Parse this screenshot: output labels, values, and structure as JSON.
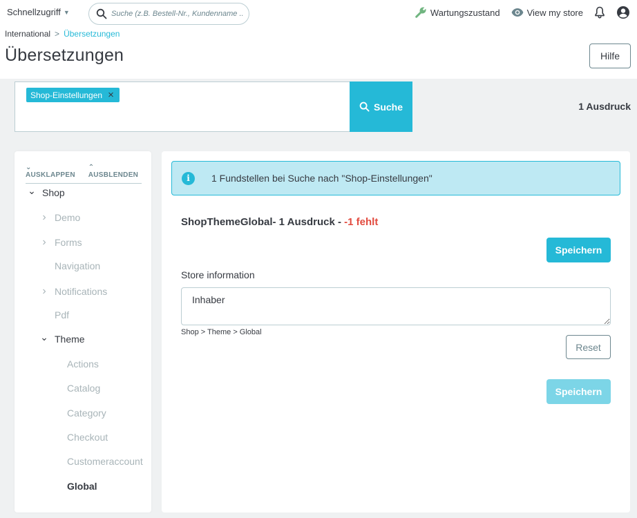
{
  "header": {
    "quick_access": "Schnellzugriff",
    "search_placeholder": "Suche (z.B. Bestell-Nr., Kundenname ...",
    "maintenance": "Wartungszustand",
    "view_store": "View my store"
  },
  "breadcrumb": {
    "parent": "International",
    "separator": ">",
    "current": "Übersetzungen"
  },
  "page_title": "Übersetzungen",
  "help_button": "Hilfe",
  "search": {
    "tag": "Shop-Einstellungen",
    "tag_remove": "×",
    "button": "Suche",
    "result_count": "1 Ausdruck"
  },
  "tree": {
    "expand": "AUSKLAPPEN",
    "collapse": "AUSBLENDEN",
    "items": [
      {
        "label": "Shop",
        "level": 0,
        "chevron": "open"
      },
      {
        "label": "Demo",
        "level": 1,
        "chevron": "closed"
      },
      {
        "label": "Forms",
        "level": 1,
        "chevron": "closed"
      },
      {
        "label": "Navigation",
        "level": 1,
        "chevron": "none"
      },
      {
        "label": "Notifications",
        "level": 1,
        "chevron": "closed"
      },
      {
        "label": "Pdf",
        "level": 1,
        "chevron": "none"
      },
      {
        "label": "Theme",
        "level": 1,
        "chevron": "open"
      },
      {
        "label": "Actions",
        "level": 2,
        "chevron": "none"
      },
      {
        "label": "Catalog",
        "level": 2,
        "chevron": "none"
      },
      {
        "label": "Category",
        "level": 2,
        "chevron": "none"
      },
      {
        "label": "Checkout",
        "level": 2,
        "chevron": "none"
      },
      {
        "label": "Customeraccount",
        "level": 2,
        "chevron": "none"
      },
      {
        "label": "Global",
        "level": 2,
        "chevron": "none",
        "active": true
      }
    ]
  },
  "main": {
    "alert": "1 Fundstellen bei Suche nach \"Shop-Einstellungen\"",
    "section_title": "ShopThemeGlobal- 1 Ausdruck - ",
    "section_missing": "-1 fehlt",
    "save_label": "Speichern",
    "field_label": "Store information",
    "field_value": "Inhaber",
    "field_path": "Shop > Theme > Global",
    "reset_label": "Reset"
  },
  "colors": {
    "primary": "#25b9d7",
    "danger": "#e24b3f",
    "alert_bg": "#bee9f3",
    "text": "#363a41",
    "muted": "#a8b4b8"
  }
}
